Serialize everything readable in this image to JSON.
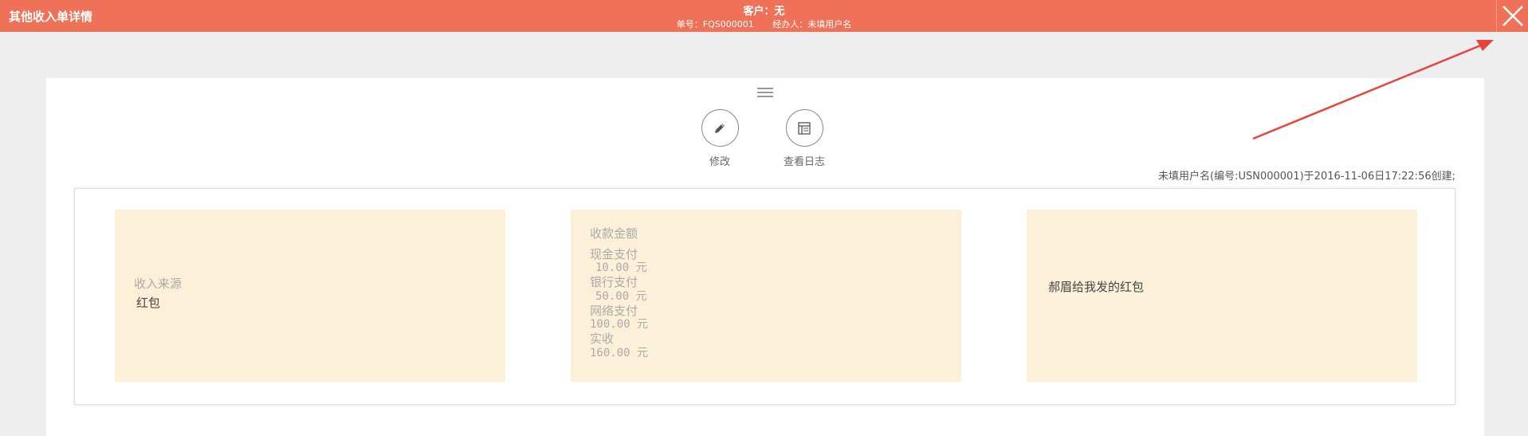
{
  "header": {
    "title": "其他收入单详情",
    "customer": "客户：无",
    "order_no": "单号：FQS000001",
    "handler": "经办人：未填用户名",
    "close_icon": "close-icon"
  },
  "toolbar": {
    "menu_icon": "hamburger-menu-icon",
    "edit_label": "修改",
    "edit_icon": "pencil-icon",
    "log_label": "查看日志",
    "log_icon": "log-icon"
  },
  "created_info": "未填用户名(编号:USN000001)于2016-11-06日17:22:56创建;",
  "income_source": {
    "label": "收入来源",
    "value": "红包"
  },
  "amounts": {
    "title": "收款金额",
    "items": [
      {
        "label": "现金支付",
        "value": "10.00 元"
      },
      {
        "label": "银行支付",
        "value": "50.00 元"
      },
      {
        "label": "网络支付",
        "value": "100.00 元"
      },
      {
        "label": "实收",
        "value": "160.00 元"
      }
    ]
  },
  "note": "郝眉给我发的红包",
  "colors": {
    "header_bg": "#ef7158",
    "box_bg": "#fcf0d9",
    "arrow": "#e8433c"
  }
}
